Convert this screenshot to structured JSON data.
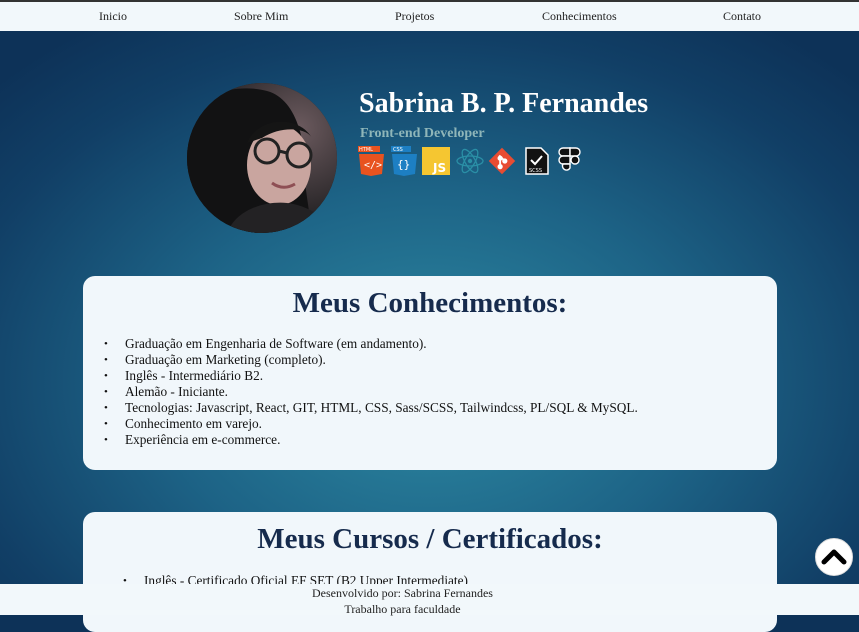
{
  "nav": {
    "items": [
      "Inicio",
      "Sobre Mim",
      "Projetos",
      "Conhecimentos",
      "Contato"
    ]
  },
  "hero": {
    "name": "Sabrina B. P. Fernandes",
    "role": "Front-end Developer",
    "tech_icons": [
      {
        "icon": "html-icon",
        "label": "HTML",
        "color": "#e8531f"
      },
      {
        "icon": "css-icon",
        "label": "CSS",
        "color": "#1d7fc3"
      },
      {
        "icon": "js-icon",
        "label": "JS",
        "color": "#f5c631"
      },
      {
        "icon": "react-icon",
        "label": "",
        "color": "#2a8fa6"
      },
      {
        "icon": "git-icon",
        "label": "",
        "color": "#e84c32"
      },
      {
        "icon": "scss-icon",
        "label": "SCSS",
        "color": "#ffffff"
      },
      {
        "icon": "figma-icon",
        "label": "",
        "color": "#ffffff"
      }
    ]
  },
  "knowledge": {
    "title": "Meus Conhecimentos:",
    "items": [
      "Graduação em Engenharia de Software (em andamento).",
      "Graduação em Marketing (completo).",
      "Inglês - Intermediário B2.",
      "Alemão - Iniciante.",
      "Tecnologias: Javascript, React, GIT, HTML, CSS, Sass/SCSS, Tailwindcss, PL/SQL & MySQL.",
      "Conhecimento em varejo.",
      "Experiência em e-commerce."
    ]
  },
  "courses": {
    "title": "Meus Cursos / Certificados:",
    "items": [
      "Inglês - Certificado Oficial EF SET (B2 Upper Intermediate)"
    ]
  },
  "footer": {
    "line1": "Desenvolvido por: Sabrina Fernandes",
    "line2": "Trabalho para faculdade"
  },
  "colors": {
    "background_dark": "#0d3258",
    "background_light": "#2d8aa3",
    "card_bg": "#f1f7fb",
    "heading": "#162b4d",
    "role_text": "#8fb6b9"
  }
}
